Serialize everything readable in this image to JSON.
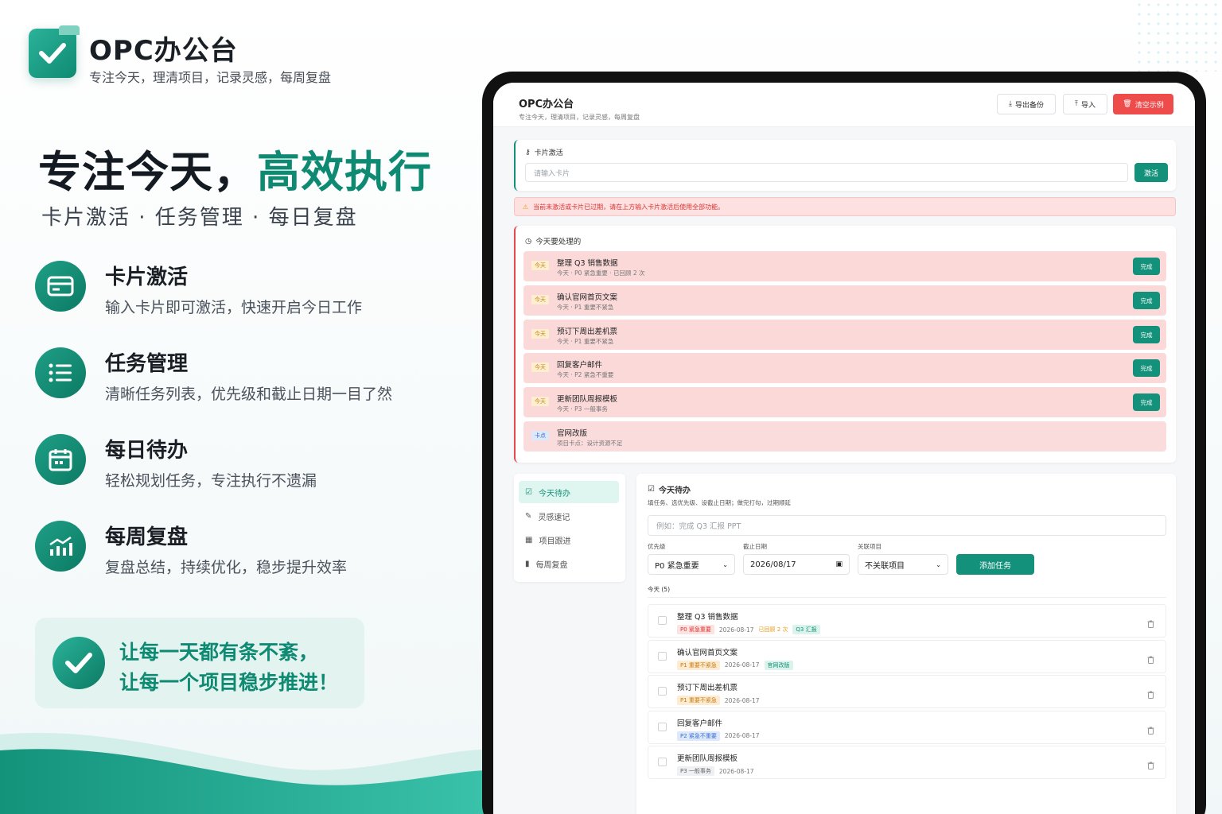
{
  "brand": {
    "name": "OPC办公台",
    "subtitle": "专注今天，理清项目，记录灵感，每周复盘"
  },
  "hero": {
    "title_main": "专注今天，",
    "title_highlight": "高效执行",
    "subtitle": "卡片激活 · 任务管理 · 每日复盘"
  },
  "features": [
    {
      "icon": "card-icon",
      "title": "卡片激活",
      "desc": "输入卡片即可激活，快速开启今日工作"
    },
    {
      "icon": "list-icon",
      "title": "任务管理",
      "desc": "清晰任务列表，优先级和截止日期一目了然"
    },
    {
      "icon": "calendar-icon",
      "title": "每日待办",
      "desc": "轻松规划任务，专注执行不遗漏"
    },
    {
      "icon": "chart-icon",
      "title": "每周复盘",
      "desc": "复盘总结，持续优化，稳步提升效率"
    }
  ],
  "slogan": {
    "line1": "让每一天都有条不紊，",
    "line2": "让每一个项目稳步推进！"
  },
  "app": {
    "title": "OPC办公台",
    "subtitle": "专注今天，理清项目，记录灵感，每周复盘",
    "buttons": {
      "export": "导出备份",
      "import": "导入",
      "clear": "清空示例"
    },
    "activation": {
      "label": "卡片激活",
      "placeholder": "请输入卡片",
      "button": "激活"
    },
    "alert": "当前未激活或卡片已过期，请在上方输入卡片激活后使用全部功能。",
    "today_section": {
      "title": "今天要处理的",
      "items": [
        {
          "tag": "今天",
          "title": "整理 Q3 销售数据",
          "meta": "今天 · P0 紧急重要 · 已回顾 2 次",
          "button": "完成"
        },
        {
          "tag": "今天",
          "title": "确认官网首页文案",
          "meta": "今天 · P1 重要不紧急",
          "button": "完成"
        },
        {
          "tag": "今天",
          "title": "预订下周出差机票",
          "meta": "今天 · P1 重要不紧急",
          "button": "完成"
        },
        {
          "tag": "今天",
          "title": "回复客户邮件",
          "meta": "今天 · P2 紧急不重要",
          "button": "完成"
        },
        {
          "tag": "今天",
          "title": "更新团队周报模板",
          "meta": "今天 · P3 一般事务",
          "button": "完成"
        },
        {
          "tag": "卡点",
          "title": "官网改版",
          "meta": "项目卡点：设计资源不足",
          "button": ""
        }
      ]
    },
    "nav": [
      {
        "icon": "checkbox-icon",
        "label": "今天待办",
        "active": true
      },
      {
        "icon": "edit-icon",
        "label": "灵感速记",
        "active": false
      },
      {
        "icon": "project-icon",
        "label": "项目跟进",
        "active": false
      },
      {
        "icon": "bar-chart-icon",
        "label": "每周复盘",
        "active": false
      }
    ],
    "todo_panel": {
      "title": "今天待办",
      "hint": "填任务、选优先级、设截止日期；做完打勾，过期顺延",
      "task_placeholder": "例如：完成 Q3 汇报 PPT",
      "priority_label": "优先级",
      "priority_value": "P0 紧急重要",
      "deadline_label": "截止日期",
      "deadline_value": "2026/08/17",
      "project_label": "关联项目",
      "project_value": "不关联项目",
      "add_button": "添加任务",
      "list_header": "今天 (5)",
      "tasks": [
        {
          "title": "整理 Q3 销售数据",
          "priority": "P0 紧急重要",
          "pclass": "p0",
          "date": "2026-08-17",
          "review": "已回顾 2 次",
          "project": "Q3 汇报"
        },
        {
          "title": "确认官网首页文案",
          "priority": "P1 重要不紧急",
          "pclass": "p1",
          "date": "2026-08-17",
          "review": "",
          "project": "官网改版"
        },
        {
          "title": "预订下周出差机票",
          "priority": "P1 重要不紧急",
          "pclass": "p1",
          "date": "2026-08-17",
          "review": "",
          "project": ""
        },
        {
          "title": "回复客户邮件",
          "priority": "P2 紧急不重要",
          "pclass": "p2",
          "date": "2026-08-17",
          "review": "",
          "project": ""
        },
        {
          "title": "更新团队周报模板",
          "priority": "P3 一般事务",
          "pclass": "p3",
          "date": "2026-08-17",
          "review": "",
          "project": ""
        }
      ]
    }
  },
  "colors": {
    "accent": "#13917a",
    "danger": "#ee4b4b",
    "todo_bg": "#fbd9d9"
  }
}
